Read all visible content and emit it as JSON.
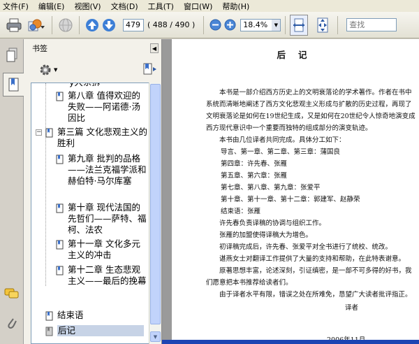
{
  "menu": [
    {
      "label": "文件(F)"
    },
    {
      "label": "编辑(E)"
    },
    {
      "label": "视图(V)"
    },
    {
      "label": "文档(D)"
    },
    {
      "label": "工具(T)"
    },
    {
      "label": "窗口(W)"
    },
    {
      "label": "帮助(H)"
    }
  ],
  "toolbar": {
    "page_current": "479",
    "page_count": "( 488 / 490 )",
    "zoom": "18.4%",
    "search_placeholder": "查找"
  },
  "panel": {
    "title": "书签",
    "bookmarks": [
      {
        "label": "第八章 值得欢迎的失败——阿诺德·汤因比"
      },
      {
        "label": "第三篇 文化悲观主义的胜利"
      },
      {
        "label": "第九章 批判的品格——法兰克福学派和赫伯特·马尔库塞"
      },
      {
        "label": "第十章 现代法国的先哲们——萨特、福柯、法农"
      },
      {
        "label": "第十一章 文化多元主义的冲击"
      },
      {
        "label": "第十二章 生态悲观主义——最后的挽幕"
      },
      {
        "label": "结束语"
      },
      {
        "label": "后记"
      }
    ]
  },
  "page": {
    "title": "后记",
    "paragraph1": "本书是一部介绍西方历史上的文明衰落论的学术著作。作者在书中系统而清晰地阐述了西方文化悲观主义形成与扩散的历史过程，再现了文明衰落论是如何在19世纪生成，又是如何在20世纪令人惊奇地演变成西方现代意识中一个重要而独特的组成部分的演变轨迹。",
    "intro": "本书由几位译者共同完成。具体分工如下：",
    "assignments": [
      "导言、第一章、第二章、第三章：蒲国良",
      "第四章：许先春、张雁",
      "第五章、第六章：张雁",
      "第七章、第八章、第九章：张爱平",
      "第十章、第十一章、第十二章：郭建军、赵静荣",
      "结束语：张雁"
    ],
    "lines": [
      "许先春负责译稿的协调与组织工作。",
      "张雁的加盟使得译稿大为增色。",
      "初译稿完成后，许先春、张爱平对全书进行了统校、统改。",
      "谌燕女士对翻译工作提供了大量的支持和帮助，在此特表谢意。",
      "原著思想丰富，论述深刻，引证缜密，是一部不可多得的好书，我们愿意把本书推荐给读者们。",
      "由于译者水平有限，错误之处在所难免，恳望广大读者批评指正。"
    ],
    "signature": "译者",
    "date": "2006年11月"
  }
}
